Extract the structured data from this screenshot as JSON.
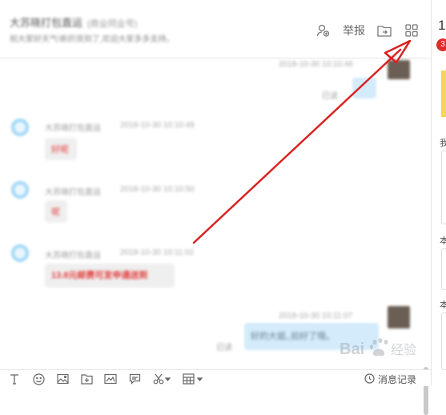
{
  "header": {
    "title": "大苏晓打包直运",
    "title_tag": "(商业同业号)",
    "subtitle": "祝大家好天气!新的货到了,欢迎大家多多支持。",
    "report_label": "举报",
    "icons": [
      "add-friend-icon",
      "folder-share-icon",
      "app-grid-icon"
    ]
  },
  "messages": [
    {
      "direction": "out",
      "time": "2018-10-30 10:10:46",
      "read": "已读",
      "text": ""
    },
    {
      "direction": "in",
      "sender": "大苏晓打包直运",
      "time": "2018-10-30 10:10:49",
      "text": "好呢"
    },
    {
      "direction": "in",
      "sender": "大苏晓打包直运",
      "time": "2018-10-30 10:10:50",
      "text": "呢"
    },
    {
      "direction": "in",
      "sender": "大苏晓打包直运",
      "time": "2018-10-30 10:11:02",
      "text": "13.8元邮费可发申通送到"
    },
    {
      "direction": "out",
      "time": "2018-10-30 10:11:07",
      "read": "已读",
      "text": "好的大姐,,拍好了哦。"
    }
  ],
  "toolbar": {
    "icons": [
      "text-format-icon",
      "emoji-icon",
      "image-icon",
      "file-icon",
      "screenshot-icon",
      "chat-bubble-icon",
      "scissors-icon",
      "calculator-icon"
    ],
    "history_label": "消息记录"
  },
  "right_panel": {
    "number": "1",
    "badge": "3",
    "label_a": "我",
    "label_b": "本",
    "label_c": "本"
  },
  "watermark": {
    "text": "Bai 经验"
  },
  "colors": {
    "accent_red": "#e02b2b",
    "bubble_out": "#d4ebfb",
    "annotation_arrow": "#d92222"
  }
}
